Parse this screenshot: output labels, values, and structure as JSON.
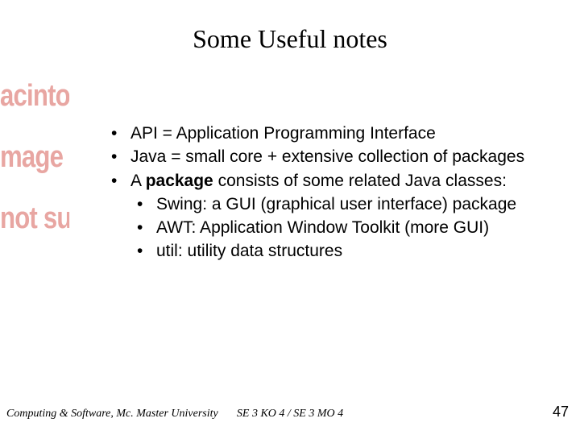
{
  "title": "Some Useful notes",
  "bg": {
    "line1": "acintosh P",
    "line2": "mage form",
    "line3": "not suppo"
  },
  "bullets": {
    "b1": "API = Application Programming Interface",
    "b2": "Java = small core + extensive collection of packages",
    "b3_pre": "A ",
    "b3_bold": "package",
    "b3_post": " consists of some related Java classes:",
    "b3a": "Swing: a GUI (graphical user interface) package",
    "b3b": "AWT: Application Window Toolkit (more GUI)",
    "b3c": "util: utility data structures"
  },
  "footer": {
    "left": "Computing & Software, Mc. Master University",
    "center": "SE 3 KO 4 / SE 3 MO 4",
    "right": "47"
  }
}
